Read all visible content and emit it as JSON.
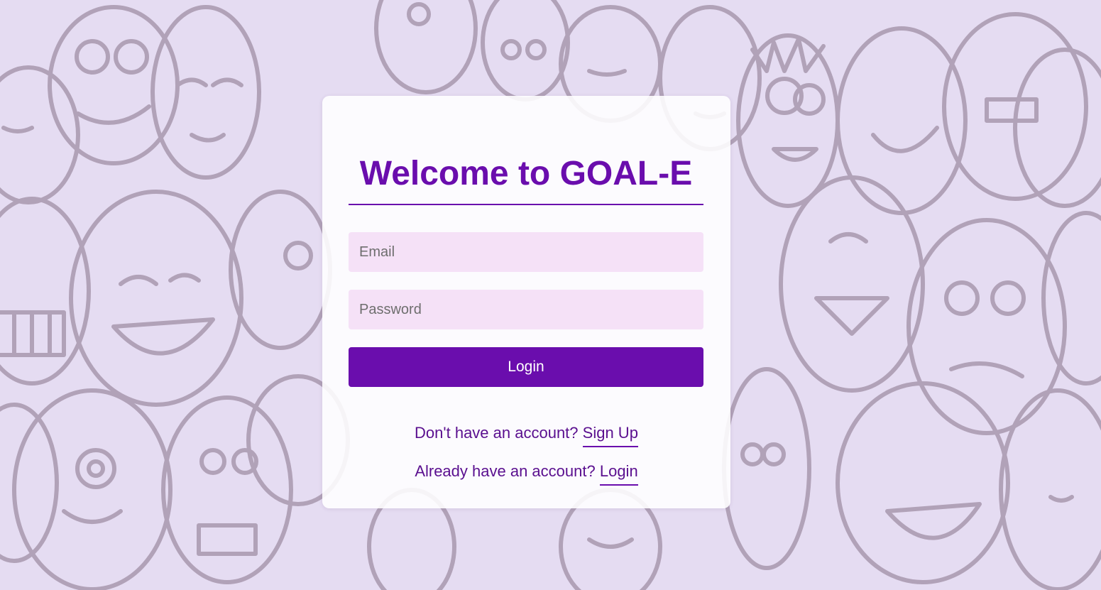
{
  "login_card": {
    "title": "Welcome to GOAL-E",
    "email_placeholder": "Email",
    "password_placeholder": "Password",
    "login_button_label": "Login",
    "signup_prompt": "Don't have an account?",
    "signup_link": "Sign Up",
    "login_prompt": "Already have an account?",
    "login_link": "Login"
  },
  "colors": {
    "accent": "#6a0dad",
    "input_background": "#f5e1f7",
    "page_background": "#e6dcf2"
  }
}
